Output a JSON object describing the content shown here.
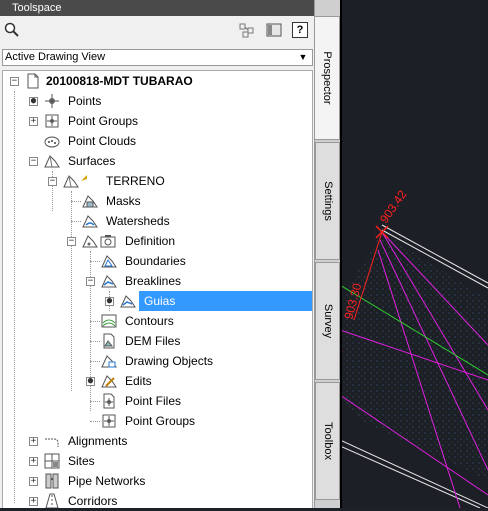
{
  "panel": {
    "title": "Toolspace",
    "help_label": "?",
    "view_select": {
      "value": "Active Drawing View"
    }
  },
  "tree": {
    "drawing": "20100818-MDT TUBARAO",
    "points": "Points",
    "point_groups": "Point Groups",
    "point_clouds": "Point Clouds",
    "surfaces": "Surfaces",
    "terreno": "TERRENO",
    "masks": "Masks",
    "watersheds": "Watersheds",
    "definition": "Definition",
    "boundaries": "Boundaries",
    "breaklines": "Breaklines",
    "guias": "Guias",
    "contours": "Contours",
    "dem_files": "DEM Files",
    "drawing_objects": "Drawing Objects",
    "edits": "Edits",
    "point_files": "Point Files",
    "point_groups_sub": "Point Groups",
    "alignments": "Alignments",
    "sites": "Sites",
    "pipe_networks": "Pipe Networks",
    "corridors": "Corridors"
  },
  "tabs": {
    "prospector": "Prospector",
    "settings": "Settings",
    "survey": "Survey",
    "toolbox": "Toolbox"
  },
  "drawing": {
    "label_top": "903.42",
    "label_left": "903.30",
    "label_left_prefix": "54"
  },
  "colors": {
    "selection": "#3399ff",
    "magenta": "#e020e0",
    "red": "#ff2020",
    "green": "#30d030",
    "canvas": "#1c1f26"
  }
}
